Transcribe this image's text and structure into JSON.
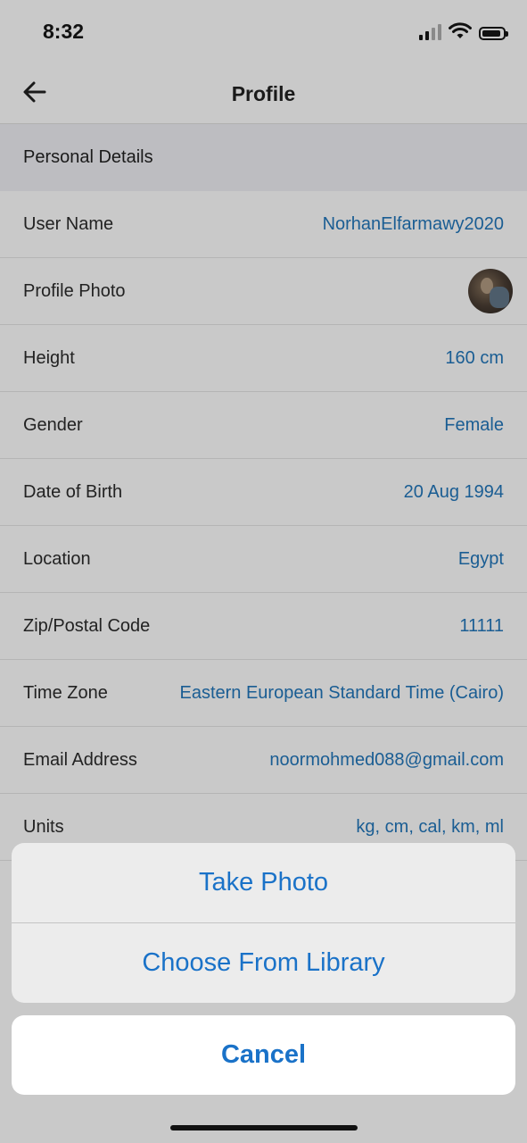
{
  "status_bar": {
    "time": "8:32"
  },
  "header": {
    "title": "Profile"
  },
  "section": {
    "title": "Personal Details"
  },
  "rows": [
    {
      "label": "User Name",
      "value": "NorhanElfarmawy2020"
    },
    {
      "label": "Profile Photo",
      "value": ""
    },
    {
      "label": "Height",
      "value": "160 cm"
    },
    {
      "label": "Gender",
      "value": "Female"
    },
    {
      "label": "Date of Birth",
      "value": "20 Aug 1994"
    },
    {
      "label": "Location",
      "value": "Egypt"
    },
    {
      "label": "Zip/Postal Code",
      "value": "11111"
    },
    {
      "label": "Time Zone",
      "value": "Eastern European Standard Time (Cairo)"
    },
    {
      "label": "Email Address",
      "value": "noormohmed088@gmail.com"
    },
    {
      "label": "Units",
      "value": "kg, cm, cal, km, ml"
    }
  ],
  "action_sheet": {
    "take_photo": "Take Photo",
    "choose_from_library": "Choose From Library",
    "cancel": "Cancel"
  },
  "icons": {
    "back": "arrow-left-icon",
    "signal": "cellular-signal-icon",
    "wifi": "wifi-icon",
    "battery": "battery-icon"
  },
  "colors": {
    "accent": "#1a72c8",
    "value_text": "#1a5d93",
    "dimmed_background": "#c9c9c9"
  }
}
